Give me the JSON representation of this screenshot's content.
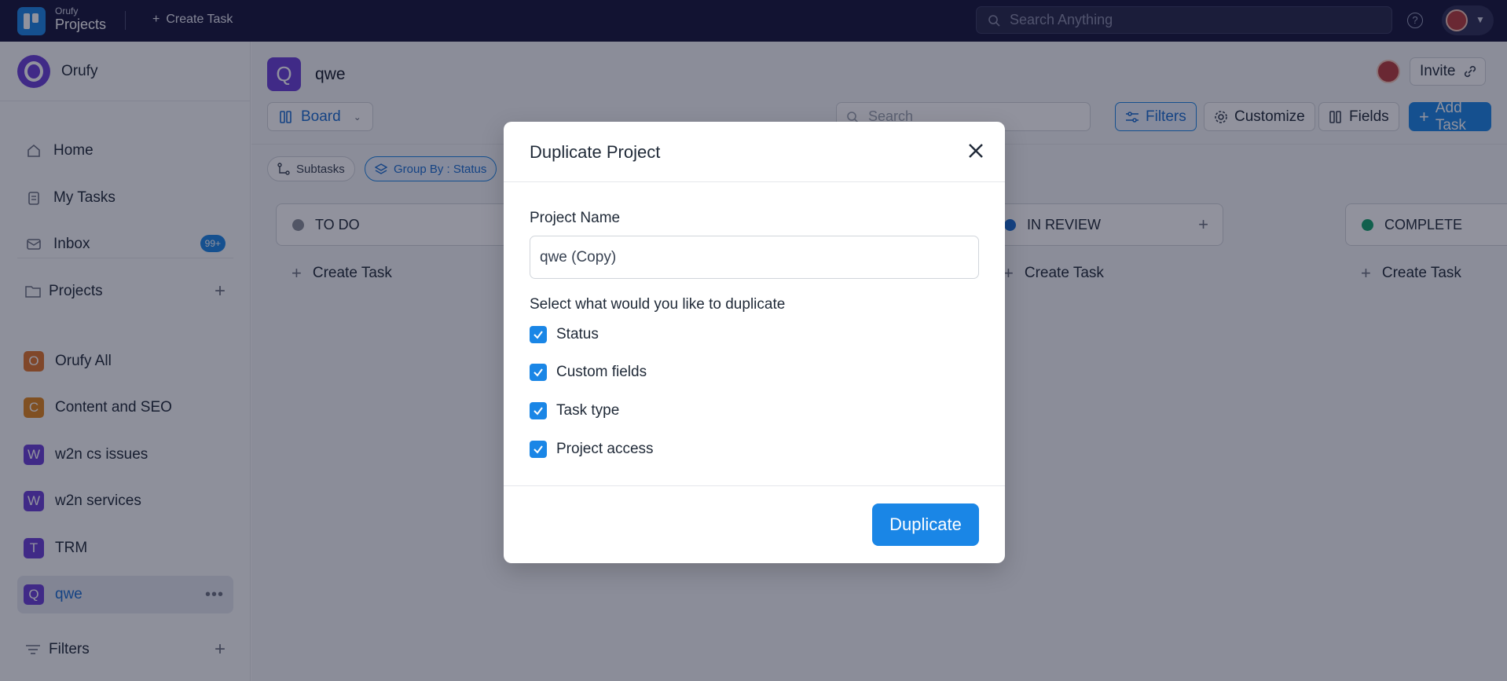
{
  "topbar": {
    "brand_small": "Orufy",
    "brand_big": "Projects",
    "create_task": "Create Task",
    "search_placeholder": "Search Anything"
  },
  "sidebar": {
    "org_name": "Orufy",
    "nav": [
      {
        "label": "Home",
        "icon": "home-icon"
      },
      {
        "label": "My Tasks",
        "icon": "clipboard-icon"
      },
      {
        "label": "Inbox",
        "icon": "inbox-icon",
        "badge": "99+"
      }
    ],
    "projects_label": "Projects",
    "projects": [
      {
        "letter": "O",
        "name": "Orufy All",
        "color": "#e0752b"
      },
      {
        "letter": "C",
        "name": "Content and SEO",
        "color": "#e0861c"
      },
      {
        "letter": "W",
        "name": "w2n cs issues",
        "color": "#6a3fd6"
      },
      {
        "letter": "W",
        "name": "w2n services",
        "color": "#6a3fd6"
      },
      {
        "letter": "T",
        "name": "TRM",
        "color": "#6a3fd6"
      },
      {
        "letter": "Q",
        "name": "qwe",
        "color": "#6a3fd6",
        "active": true
      }
    ],
    "filters_label": "Filters"
  },
  "main": {
    "project_letter": "Q",
    "project_title": "qwe",
    "invite_label": "Invite",
    "view_label": "Board",
    "search_placeholder": "Search",
    "filters_label": "Filters",
    "customize_label": "Customize",
    "fields_label": "Fields",
    "add_task_label": "Add Task",
    "subtasks_chip": "Subtasks",
    "group_by_chip": "Group By : Status",
    "columns": [
      {
        "name": "TO DO",
        "dot_color": "#8a8f98",
        "create": "Create Task"
      },
      {
        "name": "IN REVIEW",
        "dot_color": "#1a6ed1",
        "create": "Create Task"
      },
      {
        "name": "COMPLETE",
        "dot_color": "#13a36b",
        "create": "Create Task"
      }
    ]
  },
  "modal": {
    "title": "Duplicate Project",
    "project_name_label": "Project Name",
    "project_name_value": "qwe (Copy)",
    "select_label": "Select what would you like to duplicate",
    "options": [
      {
        "label": "Status",
        "checked": true
      },
      {
        "label": "Custom fields",
        "checked": true
      },
      {
        "label": "Task type",
        "checked": true
      },
      {
        "label": "Project access",
        "checked": true
      }
    ],
    "duplicate_button": "Duplicate"
  },
  "colors": {
    "topbar_bg": "#16163a",
    "accent": "#1a86e6",
    "overlay": "rgba(16,18,42,0.46)"
  }
}
